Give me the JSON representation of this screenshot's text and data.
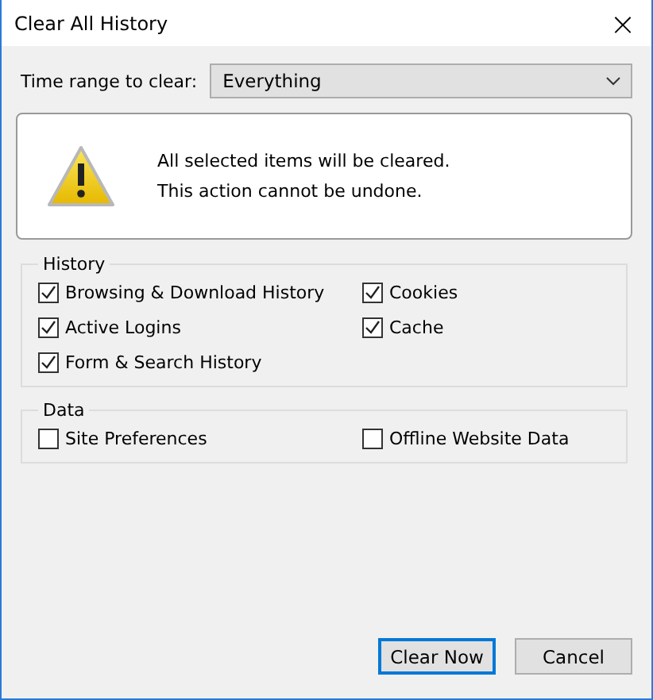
{
  "window": {
    "title": "Clear All History",
    "close": "×"
  },
  "time_range": {
    "label": "Time range to clear:",
    "value": "Everything"
  },
  "warning": {
    "lines": [
      "All selected items will be cleared.",
      "This action cannot be undone."
    ]
  },
  "groups": [
    {
      "title": "History",
      "items": [
        {
          "label": "Browsing & Download History",
          "checked": true
        },
        {
          "label": "Cookies",
          "checked": true
        },
        {
          "label": "Active Logins",
          "checked": true
        },
        {
          "label": "Cache",
          "checked": true
        },
        {
          "label": "Form & Search History",
          "checked": true
        }
      ]
    },
    {
      "title": "Data",
      "items": [
        {
          "label": "Site Preferences",
          "checked": false
        },
        {
          "label": "Offline Website Data",
          "checked": false
        }
      ]
    }
  ],
  "buttons": [
    {
      "label": "Clear Now",
      "default": true
    },
    {
      "label": "Cancel",
      "default": false
    }
  ]
}
